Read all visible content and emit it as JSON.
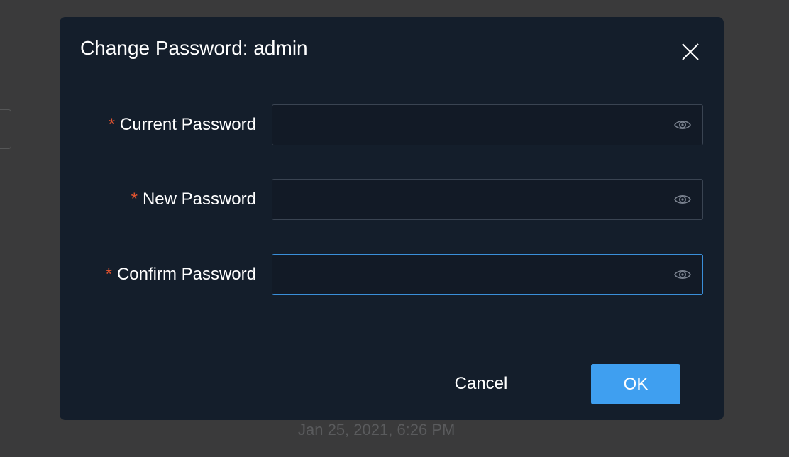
{
  "background": {
    "timestamp": "Jan 25, 2021, 6:26 PM"
  },
  "dialog": {
    "title": "Change Password: admin",
    "close_icon": "close-icon",
    "fields": [
      {
        "label": "Current Password",
        "required_mark": "*",
        "value": "",
        "placeholder": "",
        "focused": false,
        "toggle_icon": "eye-icon"
      },
      {
        "label": "New Password",
        "required_mark": "*",
        "value": "",
        "placeholder": "",
        "focused": false,
        "toggle_icon": "eye-icon"
      },
      {
        "label": "Confirm Password",
        "required_mark": "*",
        "value": "",
        "placeholder": "",
        "focused": true,
        "toggle_icon": "eye-icon"
      }
    ],
    "cancel_label": "Cancel",
    "ok_label": "OK"
  },
  "colors": {
    "accent": "#3f9ff0",
    "required": "#e0532f",
    "dialog_bg": "#141e2b",
    "focus_border": "#3a8fd9"
  }
}
